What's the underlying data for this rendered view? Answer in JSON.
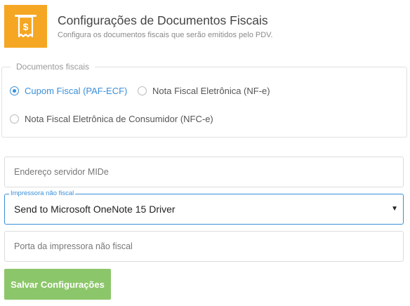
{
  "header": {
    "icon": "receipt-dollar-icon",
    "title": "Configurações de Documentos Fiscais",
    "subtitle": "Configura os documentos fiscais que serão emitidos pelo PDV.",
    "accent_color": "#f5a623"
  },
  "documents": {
    "legend": "Documentos fiscais",
    "options": [
      {
        "label": "Cupom Fiscal (PAF-ECF)",
        "checked": true
      },
      {
        "label": "Nota Fiscal Eletrônica (NF-e)",
        "checked": false
      },
      {
        "label": "Nota Fiscal Eletrônica de Consumidor (NFC-e)",
        "checked": false
      }
    ],
    "selected_color": "#3a8fd8"
  },
  "form": {
    "mide_server": {
      "placeholder": "Endereço servidor MIDe",
      "value": ""
    },
    "printer": {
      "label": "Impressora não fiscal",
      "value": "Send to Microsoft OneNote 15 Driver"
    },
    "printer_port": {
      "placeholder": "Porta da impressora não fiscal",
      "value": ""
    }
  },
  "actions": {
    "save_label": "Salvar Configurações",
    "save_color": "#8cc66a"
  }
}
